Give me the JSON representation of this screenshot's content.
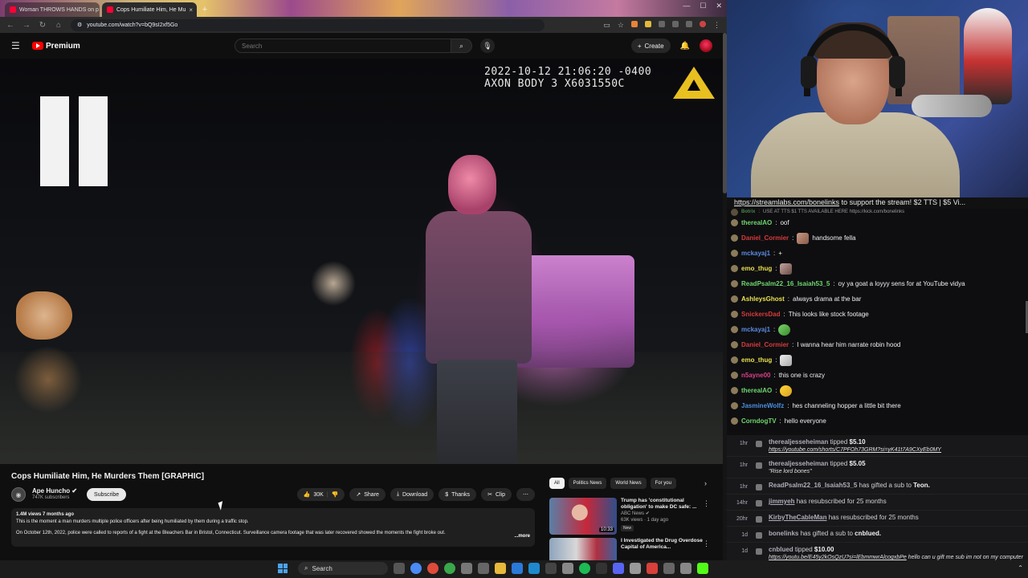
{
  "browser": {
    "tabs": [
      {
        "label": "Woman THROWS HANDS on p"
      },
      {
        "label": "Cops Humiliate Him, He Mu"
      }
    ],
    "new_tab": "+",
    "url": "youtube.com/watch?v=bQ9sI2xf5Go"
  },
  "youtube": {
    "logo_text": "Premium",
    "search_placeholder": "Search",
    "create_label": "Create",
    "video": {
      "timestamp_line1": "2022-10-12 21:06:20 -0400",
      "timestamp_line2": "AXON BODY 3 X6031550C"
    },
    "title": "Cops Humiliate Him, He Murders Them [GRAPHIC]",
    "channel": {
      "name": "Ape Huncho",
      "subs": "747K subscribers"
    },
    "subscribe_label": "Subscribe",
    "actions": {
      "likes": "30K",
      "share": "Share",
      "download": "Download",
      "thanks": "Thanks",
      "clip": "Clip"
    },
    "description": {
      "stats": "1.4M views  7 months ago",
      "line1": "This is the moment a man murders multiple police officers after being humiliated by them during a traffic stop.",
      "line2": "On October 12th, 2022, police were called to reports of a fight at the Bleachers Bar in Bristol, Connecticut. Surveillance camera footage that was later recovered showed the moments the fight broke out.",
      "more": "...more"
    },
    "chips": [
      "All",
      "Politics News",
      "World News",
      "For you"
    ],
    "recs": [
      {
        "title": "Trump has 'constitutional obligation' to make DC safe: ...",
        "channel": "ABC News",
        "stats": "63K views · 1 day ago",
        "badge": "New",
        "duration": "10:33"
      },
      {
        "title": "I Investigated the Drug Overdose Capital of America...",
        "channel": "",
        "stats": "",
        "badge": "",
        "duration": ""
      }
    ]
  },
  "stream": {
    "banner_link": "https://streamlabs.com/bonelinks",
    "banner_rest": " to support the stream! $2 TTS | $5 Vi..."
  },
  "chat": [
    {
      "user": "Botrix",
      "text": "USE AT TTS $1 TTS AVAILABLE HERE https://kick.com/bonelinks",
      "color": "#6fd66f",
      "cut": true
    },
    {
      "user": "therealAO",
      "text": "oof",
      "color": "#6fd66f"
    },
    {
      "user": "Daniel_Cormier",
      "text": "handsome fella",
      "color": "#d83a3a",
      "emote": "e1"
    },
    {
      "user": "mckayaj1",
      "text": "+",
      "color": "#5a8ae0"
    },
    {
      "user": "emo_thug",
      "text": "",
      "color": "#e8e050",
      "emote": "e2"
    },
    {
      "user": "ReadPsalm22_16_Isaiah53_5",
      "text": "oy ya goat a loyyy sens for at YouTube vidya",
      "color": "#6fd66f"
    },
    {
      "user": "AshleysGhost",
      "text": "always drama at the bar",
      "color": "#e8e050"
    },
    {
      "user": "SnickersDad",
      "text": "This looks like stock footage",
      "color": "#d83a3a"
    },
    {
      "user": "mckayaj1",
      "text": "",
      "color": "#5a8ae0",
      "emote": "e3"
    },
    {
      "user": "Daniel_Cormier",
      "text": "I wanna hear him narrate robin hood",
      "color": "#d83a3a"
    },
    {
      "user": "emo_thug",
      "text": "",
      "color": "#e8e050",
      "emote": "e4"
    },
    {
      "user": "n5ayne00",
      "text": "this one is crazy",
      "color": "#d8408a"
    },
    {
      "user": "therealAO",
      "text": "",
      "color": "#6fd66f",
      "emote": "e5"
    },
    {
      "user": "JasmineWolfz",
      "text": "hes channeling hopper a little bit there",
      "color": "#4a90e0"
    },
    {
      "user": "CorndogTV",
      "text": "hello everyone",
      "color": "#6fd66f"
    }
  ],
  "feed": [
    {
      "time": "1hr",
      "who": "therealjesseheiman",
      "verb": " tipped ",
      "amount": "$5.10",
      "msg": "https://youtube.com/shorts/C7PFOh73GRM?si=yK41t7A9CXyEb0MY",
      "msg_link": true
    },
    {
      "time": "1hr",
      "who": "therealjesseheiman",
      "verb": " tipped ",
      "amount": "$5.05",
      "msg": "\"Rise lord bones\"",
      "msg_link": false
    },
    {
      "time": "1hr",
      "who": "ReadPsalm22_16_Isaiah53_5",
      "verb": " has gifted a sub to ",
      "amount": "Teon.",
      "msg": "",
      "msg_link": false
    },
    {
      "time": "14hr",
      "who": "jimmyeh",
      "verb": " has resubscribed for 25 months",
      "amount": "",
      "msg": "",
      "msg_link": false,
      "u": true
    },
    {
      "time": "20hr",
      "who": "KirbyTheCableMan",
      "verb": " has resubscribed for 25 months",
      "amount": "",
      "msg": "",
      "msg_link": false,
      "u": true
    },
    {
      "time": "1d",
      "who": "bonelinks",
      "verb": " has gifted a sub to ",
      "amount": "cnblued.",
      "msg": "",
      "msg_link": false
    },
    {
      "time": "1d",
      "who": "cnblued",
      "verb": " tipped ",
      "amount": "$10.00",
      "msg": "https://youtu.be/E45y2kOsQzU?si=lEbmmwrAlcogxbPe",
      "msg_suffix": " hello can u gift me sub im not on my computer plz",
      "msg_link": true
    }
  ],
  "taskbar": {
    "search_label": "Search"
  }
}
